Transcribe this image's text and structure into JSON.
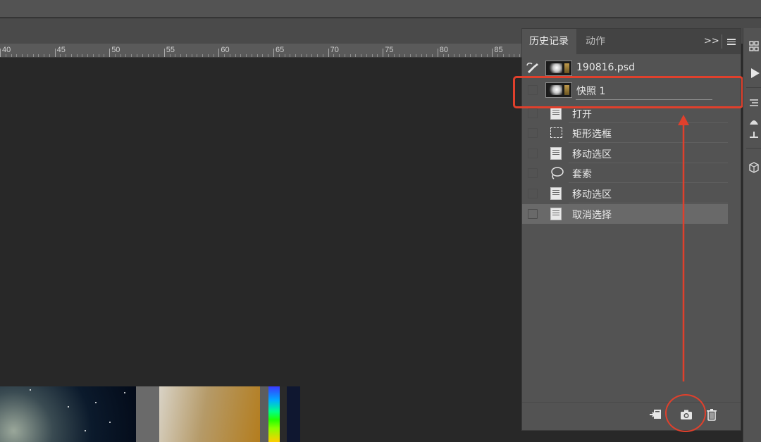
{
  "panel": {
    "tabs": [
      {
        "label": "历史记录",
        "active": true
      },
      {
        "label": "动作",
        "active": false
      }
    ],
    "collapse_label": ">>"
  },
  "ruler": {
    "labels": [
      "40",
      "45",
      "50",
      "55",
      "60",
      "65",
      "70",
      "75",
      "80",
      "85"
    ]
  },
  "history": {
    "snapshots": [
      {
        "label": "190816.psd",
        "icon": "history-brush-icon"
      },
      {
        "label": "快照 1",
        "icon": "snapshot-thumbnail"
      }
    ],
    "steps": [
      {
        "label": "打开",
        "icon": "document-icon"
      },
      {
        "label": "矩形选框",
        "icon": "rect-marquee-icon"
      },
      {
        "label": "移动选区",
        "icon": "document-icon"
      },
      {
        "label": "套索",
        "icon": "lasso-icon"
      },
      {
        "label": "移动选区",
        "icon": "document-icon"
      },
      {
        "label": "取消选择",
        "icon": "document-icon",
        "selected": true
      }
    ]
  },
  "footer": {
    "icons": [
      "new-document-from-state-icon",
      "camera-icon",
      "trash-icon"
    ]
  },
  "annotations": {
    "color": "#e0402c",
    "highlight": "snapshot-row",
    "circle": "camera-icon"
  }
}
